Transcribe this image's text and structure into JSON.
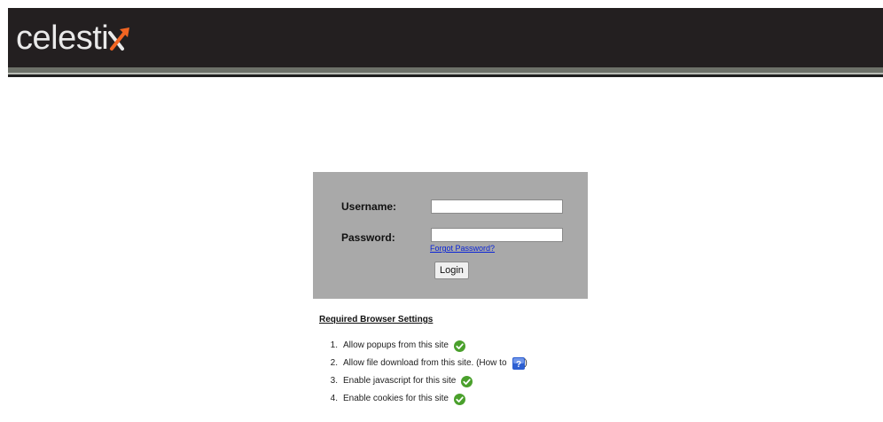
{
  "brand": {
    "name": "celesti",
    "mark": "X"
  },
  "login": {
    "username_label": "Username:",
    "password_label": "Password:",
    "username_value": "",
    "password_value": "",
    "forgot_link": "Forgot Password?",
    "login_button": "Login"
  },
  "settings": {
    "title": "Required Browser Settings",
    "items": [
      {
        "num": "1.",
        "text": "Allow popups from this site",
        "icon": "check-icon"
      },
      {
        "num": "2.",
        "text": "Allow file download from this site. (How to",
        "suffix": ")",
        "icon": "help-icon"
      },
      {
        "num": "3.",
        "text": "Enable javascript for this site",
        "icon": "check-icon"
      },
      {
        "num": "4.",
        "text": "Enable cookies for this site",
        "icon": "check-icon"
      }
    ]
  },
  "colors": {
    "header_bg": "#231f20",
    "login_box_bg": "#a9a9a9",
    "accent_orange": "#f26522",
    "check_green": "#4aa02c",
    "help_blue": "#2d5fd1"
  }
}
